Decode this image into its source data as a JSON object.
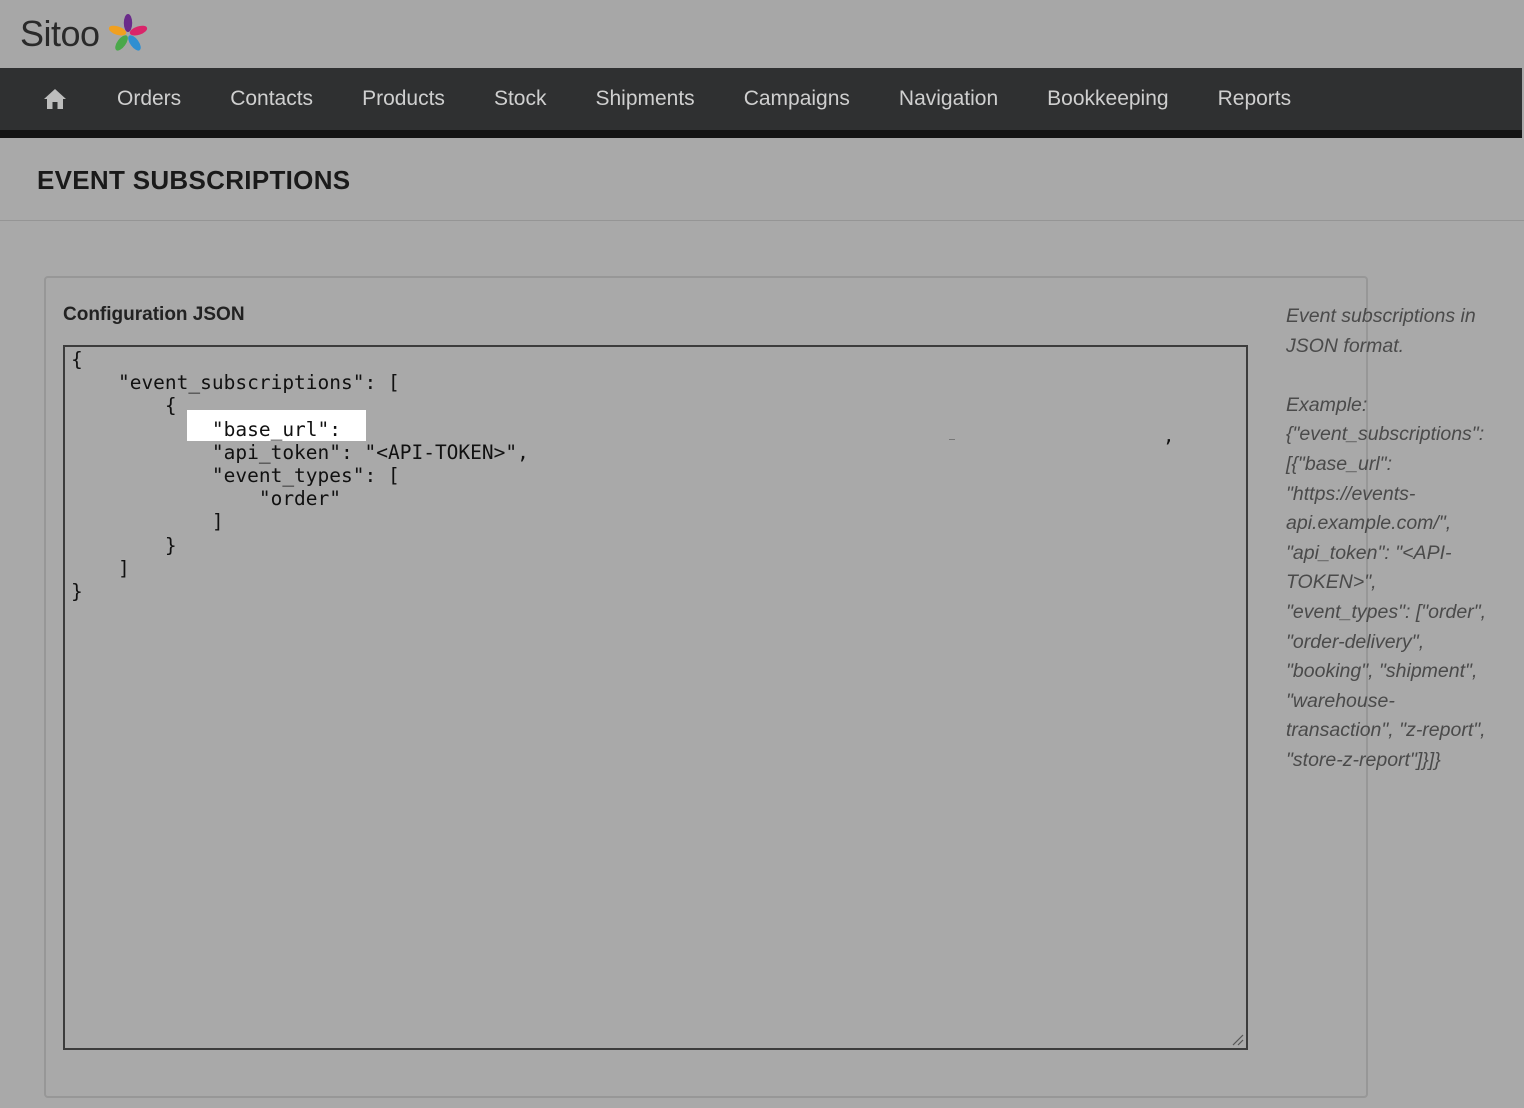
{
  "brand": {
    "name": "Sitoo",
    "logo_icon": "flower-star-icon",
    "colors": [
      "#6a2a8a",
      "#d9256a",
      "#2f8fd1",
      "#4aa84a",
      "#f0a020"
    ]
  },
  "nav": {
    "home_icon": "home-icon",
    "items": [
      {
        "label": "Orders"
      },
      {
        "label": "Contacts"
      },
      {
        "label": "Products"
      },
      {
        "label": "Stock"
      },
      {
        "label": "Shipments"
      },
      {
        "label": "Campaigns"
      },
      {
        "label": "Navigation"
      },
      {
        "label": "Bookkeeping"
      },
      {
        "label": "Reports"
      }
    ]
  },
  "page": {
    "title": "EVENT SUBSCRIPTIONS"
  },
  "config": {
    "label": "Configuration JSON",
    "value": "{\n    \"event_subscriptions\": [\n        {\n            \"base_url\":\n            \"api_token\": \"<API-TOKEN>\",\n            \"event_types\": [\n                \"order\"\n            ]\n        }\n    ]\n}",
    "stray_comma": ","
  },
  "help": {
    "description": "Event subscriptions in JSON format.",
    "example_label": "Example:",
    "example_value": "{\"event_subscriptions\": [{\"base_url\": \"https://events-api.example.com/\", \"api_token\": \"<API-TOKEN>\", \"event_types\": [\"order\", \"order-delivery\", \"booking\", \"shipment\", \"warehouse-transaction\", \"z-report\", \"store-z-report\"]}]}"
  }
}
